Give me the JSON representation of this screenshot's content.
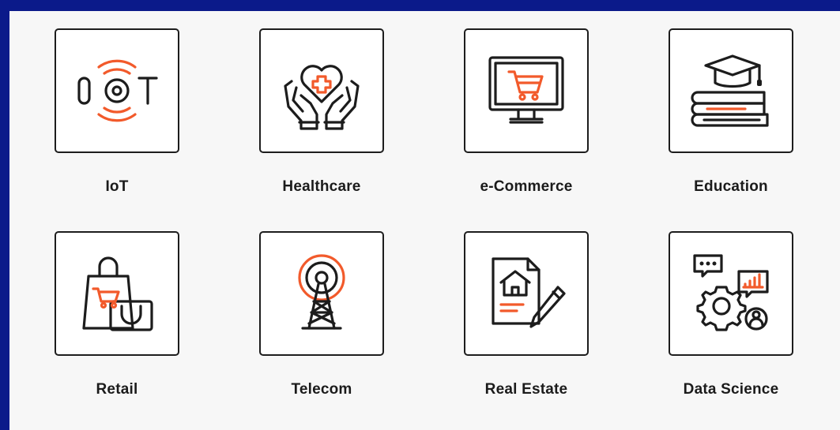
{
  "colors": {
    "frame_border": "#0b1a8a",
    "accent": "#f25a2b",
    "stroke": "#1c1c1c",
    "background": "#f7f7f7"
  },
  "tiles": [
    {
      "label": "IoT",
      "icon": "iot-icon"
    },
    {
      "label": "Healthcare",
      "icon": "hands-heart-icon"
    },
    {
      "label": "e-Commerce",
      "icon": "monitor-cart-icon"
    },
    {
      "label": "Education",
      "icon": "graduation-cap-books-icon"
    },
    {
      "label": "Retail",
      "icon": "shopping-bags-icon"
    },
    {
      "label": "Telecom",
      "icon": "radio-tower-icon"
    },
    {
      "label": "Real Estate",
      "icon": "house-document-pen-icon"
    },
    {
      "label": "Data Science",
      "icon": "gear-chart-user-icon"
    }
  ]
}
